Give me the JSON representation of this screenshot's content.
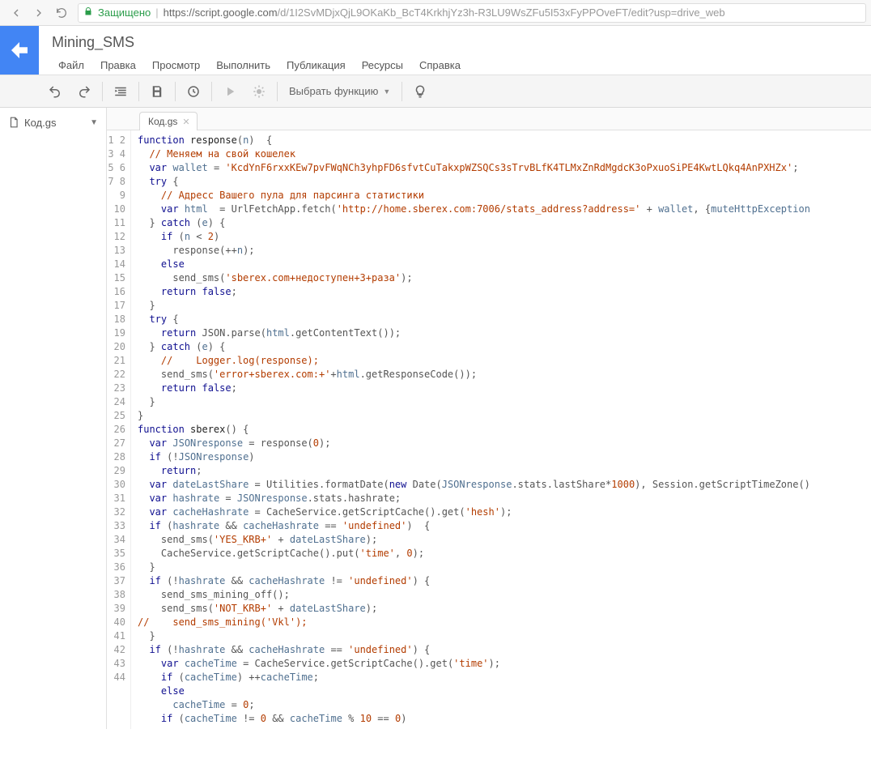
{
  "browser": {
    "secure_label": "Защищено",
    "url_host": "https://script.google.com",
    "url_path": "/d/1I2SvMDjxQjL9OKaKb_BcT4KrkhjYz3h-R3LU9WsZFu5I53xFyPPOveFT/edit?usp=drive_web"
  },
  "header": {
    "project_title": "Mining_SMS",
    "menu": [
      "Файл",
      "Правка",
      "Просмотр",
      "Выполнить",
      "Публикация",
      "Ресурсы",
      "Справка"
    ]
  },
  "toolbar": {
    "function_select": "Выбрать функцию"
  },
  "sidebar": {
    "file_label": "Код.gs"
  },
  "tabs": {
    "active": "Код.gs"
  },
  "code_lines": [
    [
      [
        "kw",
        "function"
      ],
      [
        "p",
        " "
      ],
      [
        "fn",
        "response"
      ],
      [
        "p",
        "("
      ],
      [
        "id",
        "n"
      ],
      [
        "p",
        ")  {"
      ]
    ],
    [
      [
        "p",
        "  "
      ],
      [
        "com",
        "// Меняем на свой кошелек"
      ]
    ],
    [
      [
        "p",
        "  "
      ],
      [
        "kw",
        "var"
      ],
      [
        "p",
        " "
      ],
      [
        "id",
        "wallet"
      ],
      [
        "p",
        " = "
      ],
      [
        "str",
        "'KcdYnF6rxxKEw7pvFWqNCh3yhpFD6sfvtCuTakxpWZSQCs3sTrvBLfK4TLMxZnRdMgdcK3oPxuoSiPE4KwtLQkq4AnPXHZx'"
      ],
      [
        "p",
        ";"
      ]
    ],
    [
      [
        "p",
        "  "
      ],
      [
        "kw",
        "try"
      ],
      [
        "p",
        " {"
      ]
    ],
    [
      [
        "p",
        "    "
      ],
      [
        "com",
        "// Адресс Вашего пула для парсинга статистики"
      ]
    ],
    [
      [
        "p",
        "    "
      ],
      [
        "kw",
        "var"
      ],
      [
        "p",
        " "
      ],
      [
        "id",
        "html"
      ],
      [
        "p",
        "  = UrlFetchApp.fetch("
      ],
      [
        "str",
        "'http://home.sberex.com:7006/stats_address?address='"
      ],
      [
        "p",
        " + "
      ],
      [
        "id",
        "wallet"
      ],
      [
        "p",
        ", {"
      ],
      [
        "id",
        "muteHttpException"
      ]
    ],
    [
      [
        "p",
        "  } "
      ],
      [
        "kw",
        "catch"
      ],
      [
        "p",
        " ("
      ],
      [
        "id",
        "e"
      ],
      [
        "p",
        ") {"
      ]
    ],
    [
      [
        "p",
        "    "
      ],
      [
        "kw",
        "if"
      ],
      [
        "p",
        " ("
      ],
      [
        "id",
        "n"
      ],
      [
        "p",
        " < "
      ],
      [
        "num",
        "2"
      ],
      [
        "p",
        ")"
      ]
    ],
    [
      [
        "p",
        "      response(++"
      ],
      [
        "id",
        "n"
      ],
      [
        "p",
        ");"
      ]
    ],
    [
      [
        "p",
        "    "
      ],
      [
        "kw",
        "else"
      ]
    ],
    [
      [
        "p",
        "      send_sms("
      ],
      [
        "str",
        "'sberex.com+недоступен+3+раза'"
      ],
      [
        "p",
        ");"
      ]
    ],
    [
      [
        "p",
        "    "
      ],
      [
        "kw",
        "return"
      ],
      [
        "p",
        " "
      ],
      [
        "kw",
        "false"
      ],
      [
        "p",
        ";"
      ]
    ],
    [
      [
        "p",
        "  }"
      ]
    ],
    [
      [
        "p",
        "  "
      ],
      [
        "kw",
        "try"
      ],
      [
        "p",
        " {"
      ]
    ],
    [
      [
        "p",
        "    "
      ],
      [
        "kw",
        "return"
      ],
      [
        "p",
        " JSON.parse("
      ],
      [
        "id",
        "html"
      ],
      [
        "p",
        ".getContentText());"
      ]
    ],
    [
      [
        "p",
        "  } "
      ],
      [
        "kw",
        "catch"
      ],
      [
        "p",
        " ("
      ],
      [
        "id",
        "e"
      ],
      [
        "p",
        ") {"
      ]
    ],
    [
      [
        "p",
        "    "
      ],
      [
        "com",
        "//    Logger.log(response);"
      ]
    ],
    [
      [
        "p",
        "    send_sms("
      ],
      [
        "str",
        "'error+sberex.com:+'"
      ],
      [
        "p",
        "+"
      ],
      [
        "id",
        "html"
      ],
      [
        "p",
        ".getResponseCode());"
      ]
    ],
    [
      [
        "p",
        "    "
      ],
      [
        "kw",
        "return"
      ],
      [
        "p",
        " "
      ],
      [
        "kw",
        "false"
      ],
      [
        "p",
        ";"
      ]
    ],
    [
      [
        "p",
        "  }"
      ]
    ],
    [
      [
        "p",
        "}"
      ]
    ],
    [
      [
        "p",
        ""
      ]
    ],
    [
      [
        "kw",
        "function"
      ],
      [
        "p",
        " "
      ],
      [
        "fn",
        "sberex"
      ],
      [
        "p",
        "() {"
      ]
    ],
    [
      [
        "p",
        "  "
      ],
      [
        "kw",
        "var"
      ],
      [
        "p",
        " "
      ],
      [
        "id",
        "JSONresponse"
      ],
      [
        "p",
        " = response("
      ],
      [
        "num",
        "0"
      ],
      [
        "p",
        ");"
      ]
    ],
    [
      [
        "p",
        "  "
      ],
      [
        "kw",
        "if"
      ],
      [
        "p",
        " (!"
      ],
      [
        "id",
        "JSONresponse"
      ],
      [
        "p",
        ")"
      ]
    ],
    [
      [
        "p",
        "    "
      ],
      [
        "kw",
        "return"
      ],
      [
        "p",
        ";"
      ]
    ],
    [
      [
        "p",
        "  "
      ],
      [
        "kw",
        "var"
      ],
      [
        "p",
        " "
      ],
      [
        "id",
        "dateLastShare"
      ],
      [
        "p",
        " = Utilities.formatDate("
      ],
      [
        "kw",
        "new"
      ],
      [
        "p",
        " Date("
      ],
      [
        "id",
        "JSONresponse"
      ],
      [
        "p",
        ".stats.lastShare*"
      ],
      [
        "num",
        "1000"
      ],
      [
        "p",
        "), Session.getScriptTimeZone()"
      ]
    ],
    [
      [
        "p",
        "  "
      ],
      [
        "kw",
        "var"
      ],
      [
        "p",
        " "
      ],
      [
        "id",
        "hashrate"
      ],
      [
        "p",
        " = "
      ],
      [
        "id",
        "JSONresponse"
      ],
      [
        "p",
        ".stats.hashrate;"
      ]
    ],
    [
      [
        "p",
        "  "
      ],
      [
        "kw",
        "var"
      ],
      [
        "p",
        " "
      ],
      [
        "id",
        "cacheHashrate"
      ],
      [
        "p",
        " = CacheService.getScriptCache().get("
      ],
      [
        "str",
        "'hesh'"
      ],
      [
        "p",
        ");"
      ]
    ],
    [
      [
        "p",
        "  "
      ],
      [
        "kw",
        "if"
      ],
      [
        "p",
        " ("
      ],
      [
        "id",
        "hashrate"
      ],
      [
        "p",
        " && "
      ],
      [
        "id",
        "cacheHashrate"
      ],
      [
        "p",
        " == "
      ],
      [
        "str",
        "'undefined'"
      ],
      [
        "p",
        ")  {"
      ]
    ],
    [
      [
        "p",
        "    send_sms("
      ],
      [
        "str",
        "'YES_KRB+'"
      ],
      [
        "p",
        " + "
      ],
      [
        "id",
        "dateLastShare"
      ],
      [
        "p",
        ");"
      ]
    ],
    [
      [
        "p",
        "    CacheService.getScriptCache().put("
      ],
      [
        "str",
        "'time'"
      ],
      [
        "p",
        ", "
      ],
      [
        "num",
        "0"
      ],
      [
        "p",
        ");"
      ]
    ],
    [
      [
        "p",
        "  }"
      ]
    ],
    [
      [
        "p",
        "  "
      ],
      [
        "kw",
        "if"
      ],
      [
        "p",
        " (!"
      ],
      [
        "id",
        "hashrate"
      ],
      [
        "p",
        " && "
      ],
      [
        "id",
        "cacheHashrate"
      ],
      [
        "p",
        " != "
      ],
      [
        "str",
        "'undefined'"
      ],
      [
        "p",
        ") {"
      ]
    ],
    [
      [
        "p",
        "    send_sms_mining_off();"
      ]
    ],
    [
      [
        "p",
        "    send_sms("
      ],
      [
        "str",
        "'NOT_KRB+'"
      ],
      [
        "p",
        " + "
      ],
      [
        "id",
        "dateLastShare"
      ],
      [
        "p",
        ");"
      ]
    ],
    [
      [
        "com",
        "//    send_sms_mining('Vkl');"
      ]
    ],
    [
      [
        "p",
        "  }"
      ]
    ],
    [
      [
        "p",
        "  "
      ],
      [
        "kw",
        "if"
      ],
      [
        "p",
        " (!"
      ],
      [
        "id",
        "hashrate"
      ],
      [
        "p",
        " && "
      ],
      [
        "id",
        "cacheHashrate"
      ],
      [
        "p",
        " == "
      ],
      [
        "str",
        "'undefined'"
      ],
      [
        "p",
        ") {"
      ]
    ],
    [
      [
        "p",
        "    "
      ],
      [
        "kw",
        "var"
      ],
      [
        "p",
        " "
      ],
      [
        "id",
        "cacheTime"
      ],
      [
        "p",
        " = CacheService.getScriptCache().get("
      ],
      [
        "str",
        "'time'"
      ],
      [
        "p",
        ");"
      ]
    ],
    [
      [
        "p",
        "    "
      ],
      [
        "kw",
        "if"
      ],
      [
        "p",
        " ("
      ],
      [
        "id",
        "cacheTime"
      ],
      [
        "p",
        ") ++"
      ],
      [
        "id",
        "cacheTime"
      ],
      [
        "p",
        ";"
      ]
    ],
    [
      [
        "p",
        "    "
      ],
      [
        "kw",
        "else"
      ]
    ],
    [
      [
        "p",
        "      "
      ],
      [
        "id",
        "cacheTime"
      ],
      [
        "p",
        " = "
      ],
      [
        "num",
        "0"
      ],
      [
        "p",
        ";"
      ]
    ],
    [
      [
        "p",
        "    "
      ],
      [
        "kw",
        "if"
      ],
      [
        "p",
        " ("
      ],
      [
        "id",
        "cacheTime"
      ],
      [
        "p",
        " != "
      ],
      [
        "num",
        "0"
      ],
      [
        "p",
        " && "
      ],
      [
        "id",
        "cacheTime"
      ],
      [
        "p",
        " % "
      ],
      [
        "num",
        "10"
      ],
      [
        "p",
        " == "
      ],
      [
        "num",
        "0"
      ],
      [
        "p",
        ")"
      ]
    ]
  ],
  "gutter_start": 1,
  "gutter_end": 44
}
